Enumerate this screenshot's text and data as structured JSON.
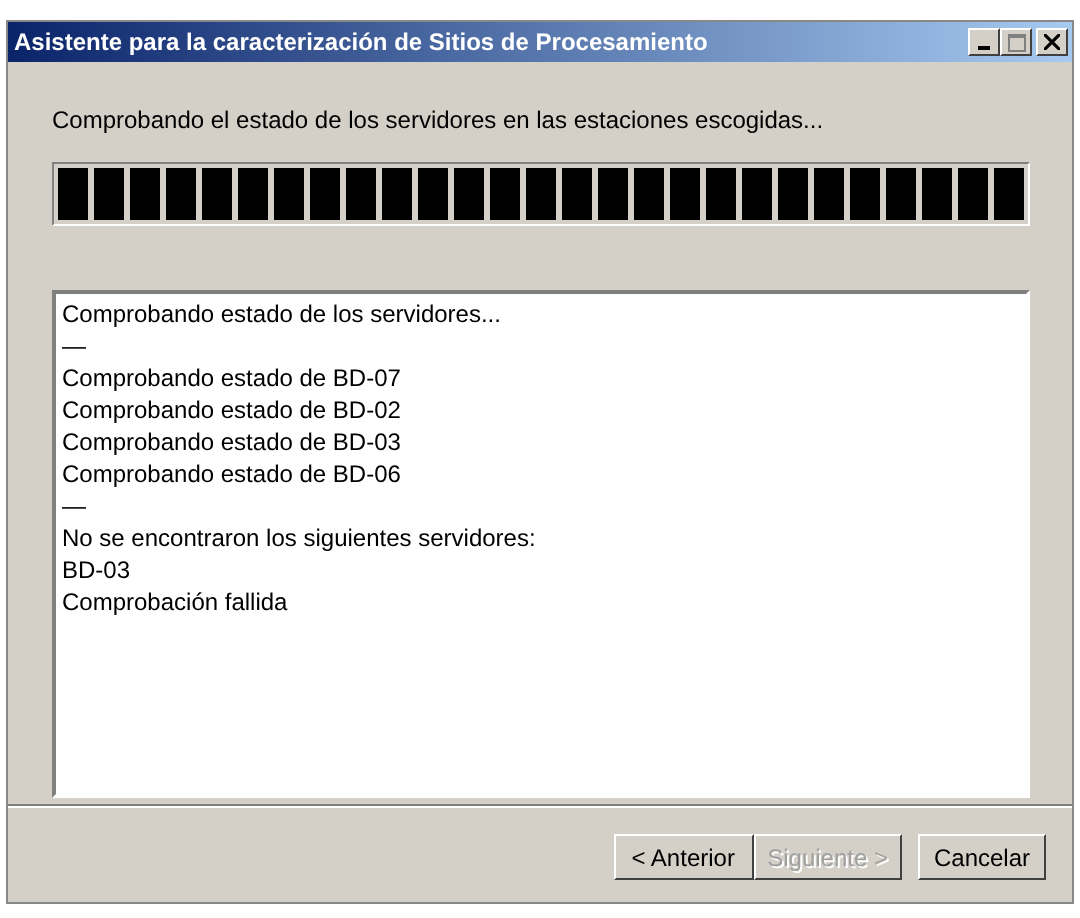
{
  "window": {
    "title": "Asistente para la caracterización de Sitios de Procesamiento"
  },
  "message": "Comprobando el estado de los servidores en las estaciones escogidas...",
  "progress": {
    "level": 1
  },
  "log": [
    "Comprobando estado de los servidores...",
    "—",
    "Comprobando estado de BD-07",
    "Comprobando estado de BD-02",
    "Comprobando estado de BD-03",
    "Comprobando estado de BD-06",
    "—",
    "No se encontraron los siguientes servidores:",
    "BD-03",
    "Comprobación fallida"
  ],
  "buttons": [
    {
      "label": "< Anterior",
      "disabled": false
    },
    {
      "label": "Siguiente >",
      "disabled": true
    },
    {
      "label": "Cancelar",
      "disabled": false
    }
  ]
}
